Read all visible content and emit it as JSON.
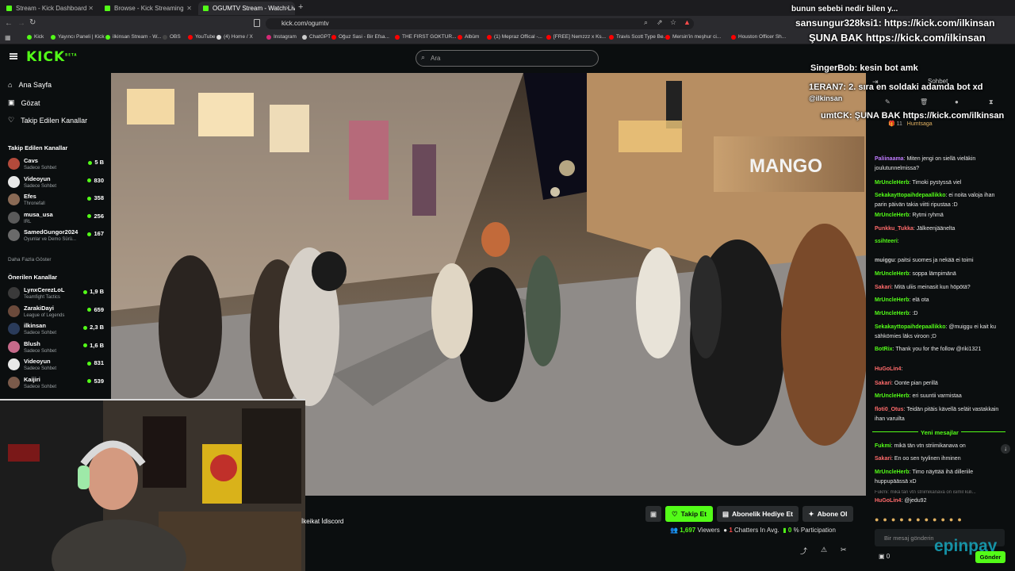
{
  "browser": {
    "tabs": [
      {
        "label": "Stream - Kick Dashboard"
      },
      {
        "label": "Browse - Kick Streaming"
      },
      {
        "label": "OGUMTV Stream - Watch Live o"
      }
    ],
    "new_tab": "+",
    "url": "kick.com/ogumtv",
    "bookmarks": [
      {
        "label": "Kick",
        "color": "#53fc18"
      },
      {
        "label": "Yayıncı Paneli | Kick",
        "color": "#53fc18"
      },
      {
        "label": "ilkinsan Stream - W...",
        "color": "#53fc18"
      },
      {
        "label": "OBS",
        "color": "#444"
      },
      {
        "label": "YouTube",
        "color": "#ff0000"
      },
      {
        "label": "(4) Home / X",
        "color": "#ddd"
      },
      {
        "label": "Instagram",
        "color": "#d62976"
      },
      {
        "label": "ChatGPT",
        "color": "#ccc"
      },
      {
        "label": "Oğuz Sasi - Bir Efsa...",
        "color": "#ff0000"
      },
      {
        "label": "THE FIRST GOKTUR...",
        "color": "#ff0000"
      },
      {
        "label": "Albüm",
        "color": "#ff0000"
      },
      {
        "label": "(1) Mepraz Offical -...",
        "color": "#ff0000"
      },
      {
        "label": "[FREE] Nemzzz x Ks...",
        "color": "#ff0000"
      },
      {
        "label": "Travis Scott Type Be...",
        "color": "#ff0000"
      },
      {
        "label": "Mersin'in meşhur ci...",
        "color": "#ff0000"
      },
      {
        "label": "Houston Officer Sh...",
        "color": "#ff0000"
      }
    ]
  },
  "kick": {
    "logo": "KICK",
    "logo_sup": "BETA",
    "search_placeholder": "Ara"
  },
  "sidebar": {
    "nav": [
      {
        "label": "Ana Sayfa"
      },
      {
        "label": "Gözat"
      },
      {
        "label": "Takip Edilen Kanallar"
      }
    ],
    "followed_header": "Takip Edilen Kanallar",
    "followed": [
      {
        "name": "Cavs",
        "category": "Sadece Sohbet",
        "viewers": "5 B",
        "color": "#b24a3b"
      },
      {
        "name": "Videoyun",
        "category": "Sadece Sohbet",
        "viewers": "830",
        "color": "#e8e8e8"
      },
      {
        "name": "Efes",
        "category": "Thronefall",
        "viewers": "358",
        "color": "#8a6a55"
      },
      {
        "name": "musa_usa",
        "category": "IRL",
        "viewers": "256",
        "color": "#5a5a5a"
      },
      {
        "name": "SamedGungor2024",
        "category": "Oyunlar ve Demo Sürü...",
        "viewers": "167",
        "color": "#6a6a6a"
      }
    ],
    "more_label": "Daha Fazla Göster",
    "recommended_header": "Önerilen Kanallar",
    "recommended": [
      {
        "name": "LynxCerezLoL",
        "category": "Teamfight Tactics",
        "viewers": "1,9 B",
        "color": "#3a3a3a"
      },
      {
        "name": "ZarakiDayi",
        "category": "League of Legends",
        "viewers": "659",
        "color": "#6b4a3b"
      },
      {
        "name": "ilkinsan",
        "category": "Sadece Sohbet",
        "viewers": "2,3 B",
        "color": "#2a3b5a"
      },
      {
        "name": "Blush",
        "category": "Sadece Sohbet",
        "viewers": "1,6 B",
        "color": "#c66a8a"
      },
      {
        "name": "Videoyun",
        "category": "Sadece Sohbet",
        "viewers": "831",
        "color": "#e8e8e8"
      },
      {
        "name": "Kaijiri",
        "category": "Sadece Sohbet",
        "viewers": "539",
        "color": "#7a5a4a"
      }
    ]
  },
  "video": {
    "store_sign": "MANGO",
    "caption": "İkeikat İdiscord"
  },
  "actions": {
    "follow": "Takip Et",
    "gift": "Abonelik Hediye Et",
    "subscribe": "Abone Ol",
    "viewers": "1,697",
    "viewers_label": "Viewers",
    "chatters": "1",
    "chatters_label": "Chatters In Avg.",
    "participation": "0",
    "participation_label": "% Participation"
  },
  "overlay": [
    {
      "text": "bunun sebebi nedir bilen y..."
    },
    {
      "text": "sansungur328ksi1: https://kick.com/ilkinsan"
    },
    {
      "text": "ŞUNA BAK https://kick.com/ilkinsan"
    },
    {
      "text": "SingerBob: kesin bot amk"
    },
    {
      "text": "1ERAN7: 2. sıra en soldaki adamda bot xd"
    },
    {
      "text": "@ilkinsan"
    },
    {
      "text": "umtCK: ŞUNA BAK https://kick.com/ilkinsan"
    }
  ],
  "chat": {
    "header": "Sohbet",
    "pinned_user": "Humtsaga",
    "pinned_count": "11",
    "messages": [
      {
        "user": "Paliinaama",
        "color": "#c07bff",
        "text": "Miten jengi on siellä vieläkin joulutunnelmissa?"
      },
      {
        "user": "MrUncleHerb",
        "color": "#53fc18",
        "text": "Timoki pystyssä viel"
      },
      {
        "user": "Sekakayttopaihdepaallikko",
        "color": "#53fc18",
        "text": "ei noita valoja ihan parin päivän takia viitti ripustaa :D"
      },
      {
        "user": "MrUncleHerb",
        "color": "#53fc18",
        "text": "Rytmi ryhmä"
      },
      {
        "user": "Punkku_Tukka",
        "color": "#ff6b6b",
        "text": "Jälkeenjäänelta"
      },
      {
        "user": "ssihteeri",
        "color": "#53fc18",
        "text": ""
      },
      {
        "user": "muiggu",
        "color": "#c7c7c7",
        "text": "paitsi suomes ja nekää ei toimi"
      },
      {
        "user": "MrUncleHerb",
        "color": "#53fc18",
        "text": "soppa lämpimänä"
      },
      {
        "user": "Sakari",
        "color": "#ff6b6b",
        "text": "Mitä uliis meinasit kun höpötä?"
      },
      {
        "user": "MrUncleHerb",
        "color": "#53fc18",
        "text": "elä ota"
      },
      {
        "user": "MrUncleHerb",
        "color": "#53fc18",
        "text": ":D"
      },
      {
        "user": "Sekakayttopaihdepaallikko",
        "color": "#53fc18",
        "text": "@muiggu ei kait ku sähkömies läks viroon ;D"
      },
      {
        "user": "BotRix",
        "color": "#53fc18",
        "text": "Thank you for the follow @riki1321"
      },
      {
        "user": "HuGoLin4",
        "color": "#ff6b6b",
        "text": ""
      },
      {
        "user": "Sakari",
        "color": "#ff6b6b",
        "text": "Oonte pian perillä"
      },
      {
        "user": "MrUncleHerb",
        "color": "#53fc18",
        "text": "eri suuntii varmistaa"
      },
      {
        "user": "floti0_Otus",
        "color": "#ff6b6b",
        "text": "Teidän pitäis kävellä seläit vastakkain ihan varuilta"
      }
    ],
    "new_messages": "Yeni mesajlar",
    "after": [
      {
        "user": "Fukmi",
        "color": "#53fc18",
        "text": "mikä tän vtn striimikanava on"
      },
      {
        "user": "Sakari",
        "color": "#ff6b6b",
        "text": "En oo sen tyylinen ihminen"
      },
      {
        "user": "MrUncleHerb",
        "color": "#53fc18",
        "text": "Timo näyttää ihä dilleriile huppupäässä xD"
      },
      {
        "user": "HuGoLin4",
        "color": "#ff6b6b",
        "text": "@jedu92"
      }
    ],
    "reply_preview": "Fukmi: mikä tän vtn striimikanava on isimil kuli...",
    "input_placeholder": "Bir mesaj gönderin",
    "send": "Gönder",
    "kick_count": "0",
    "watermark": "epinpay"
  }
}
